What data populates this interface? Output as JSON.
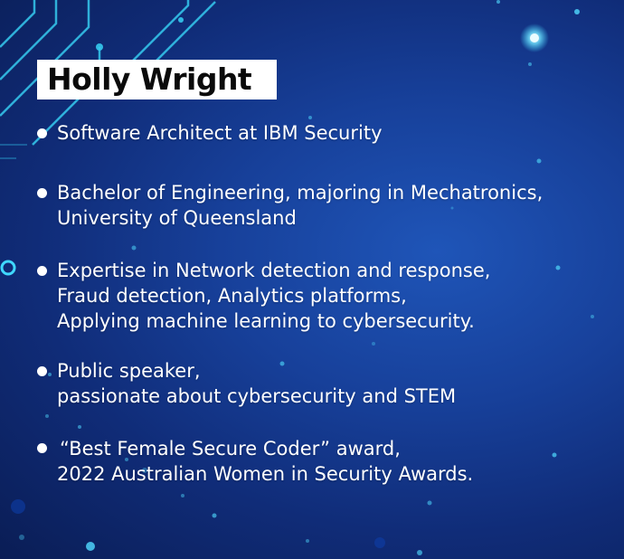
{
  "colors": {
    "background": "#17409a",
    "accent_cyan": "#3fd8ff",
    "title_box": "#ffffff",
    "text": "#ffffff"
  },
  "title": "Holly Wright",
  "bullets": [
    {
      "lines": [
        "Software Architect at IBM Security"
      ]
    },
    {
      "lines": [
        "Bachelor of Engineering, majoring in Mechatronics,",
        "University of Queensland"
      ]
    },
    {
      "lines": [
        "Expertise in Network detection and response,",
        "Fraud detection, Analytics platforms,",
        "Applying machine learning to cybersecurity."
      ]
    },
    {
      "lines": [
        "Public speaker,",
        "passionate about cybersecurity and STEM"
      ]
    },
    {
      "lines": [
        "“Best Female Secure Coder” award,",
        "2022 Australian Women in Security Awards."
      ]
    }
  ]
}
